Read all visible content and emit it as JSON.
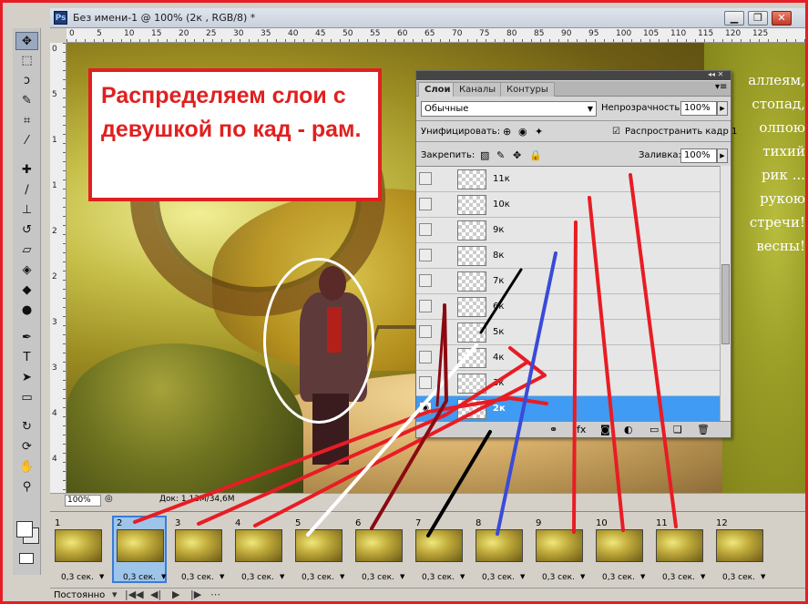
{
  "window": {
    "tab_title": "Без имени-1 @ 100% (2к , RGB/8) *",
    "app_badge": "Ps",
    "minimize": "▁",
    "restore": "❐",
    "close": "✕"
  },
  "toolbar": {
    "collapse": "»",
    "tools": [
      "move-icon",
      "marquee-icon",
      "lasso-icon",
      "quick-select-icon",
      "crop-icon",
      "eyedropper-icon",
      "healing-icon",
      "brush-icon",
      "stamp-icon",
      "history-brush-icon",
      "eraser-icon",
      "bucket-icon",
      "blur-icon",
      "dodge-icon",
      "pen-icon",
      "type-icon",
      "path-select-icon",
      "shape-icon",
      "3d-rotate-icon",
      "3d-orbit-icon",
      "hand-icon",
      "zoom-icon"
    ]
  },
  "ruler": {
    "top": [
      "0",
      "5",
      "10",
      "15",
      "20",
      "25",
      "30",
      "35",
      "40",
      "45",
      "50",
      "55",
      "60",
      "65",
      "70",
      "75",
      "80",
      "85",
      "90",
      "95",
      "100",
      "105",
      "110",
      "115",
      "120",
      "125"
    ],
    "left": [
      "0",
      "5",
      "1",
      "1",
      "2",
      "2",
      "3",
      "3",
      "4",
      "4"
    ]
  },
  "canvas": {
    "caption": "Распределяем слои с девушкой по кад - рам.",
    "poem": [
      "аллеям,",
      "стопад,",
      "олпою",
      "тихий",
      "рик ...",
      "рукою",
      "стречи!",
      "весны!"
    ]
  },
  "status": {
    "zoom": "100%",
    "doc_size": "Док: 1,12M/34,6M"
  },
  "layers_panel": {
    "tabs": [
      "Слои",
      "Каналы",
      "Контуры"
    ],
    "blend_mode": "Обычные",
    "opacity_label": "Непрозрачность:",
    "opacity_value": "100%",
    "unify_label": "Унифицировать:",
    "propagate_label": "Распространить кадр 1",
    "lock_label": "Закрепить:",
    "fill_label": "Заливка:",
    "fill_value": "100%",
    "layers": [
      {
        "name": "11к",
        "visible": false,
        "selected": false
      },
      {
        "name": "10к",
        "visible": false,
        "selected": false
      },
      {
        "name": "9к",
        "visible": false,
        "selected": false
      },
      {
        "name": "8к",
        "visible": false,
        "selected": false
      },
      {
        "name": "7к",
        "visible": false,
        "selected": false
      },
      {
        "name": "6к",
        "visible": false,
        "selected": false
      },
      {
        "name": "5к",
        "visible": false,
        "selected": false
      },
      {
        "name": "4к",
        "visible": false,
        "selected": false
      },
      {
        "name": "3к",
        "visible": false,
        "selected": false
      },
      {
        "name": "2к",
        "visible": true,
        "selected": true
      }
    ]
  },
  "animation": {
    "frames": [
      {
        "num": "1",
        "time": "0,3 сек."
      },
      {
        "num": "2",
        "time": "0,3 сек."
      },
      {
        "num": "3",
        "time": "0,3 сек."
      },
      {
        "num": "4",
        "time": "0,3 сек."
      },
      {
        "num": "5",
        "time": "0,3 сек."
      },
      {
        "num": "6",
        "time": "0,3 сек."
      },
      {
        "num": "7",
        "time": "0,3 сек."
      },
      {
        "num": "8",
        "time": "0,3 сек."
      },
      {
        "num": "9",
        "time": "0,3 сек."
      },
      {
        "num": "10",
        "time": "0,3 сек."
      },
      {
        "num": "11",
        "time": "0,3 сек."
      },
      {
        "num": "12",
        "time": "0,3 сек."
      }
    ],
    "selected_frame": "2",
    "loop": "Постоянно",
    "controls": [
      "first-frame-icon",
      "prev-frame-icon",
      "play-icon",
      "next-frame-icon",
      "tween-icon"
    ]
  },
  "colors": {
    "annotation_red": "#e02020",
    "selection_blue": "#3f9bf3",
    "frame_border": "#e81c24"
  },
  "annotations": [
    {
      "color": "#e81c24"
    },
    {
      "color": "#e81c24"
    },
    {
      "color": "#e81c24"
    },
    {
      "color": "#ffffff"
    },
    {
      "color": "#8b0a12"
    },
    {
      "color": "#000000"
    },
    {
      "color": "#3a4bd8"
    },
    {
      "color": "#e81c24"
    },
    {
      "color": "#e81c24"
    },
    {
      "color": "#e81c24"
    },
    {
      "color": "#000000"
    },
    {
      "color": "#8b0a12"
    }
  ]
}
